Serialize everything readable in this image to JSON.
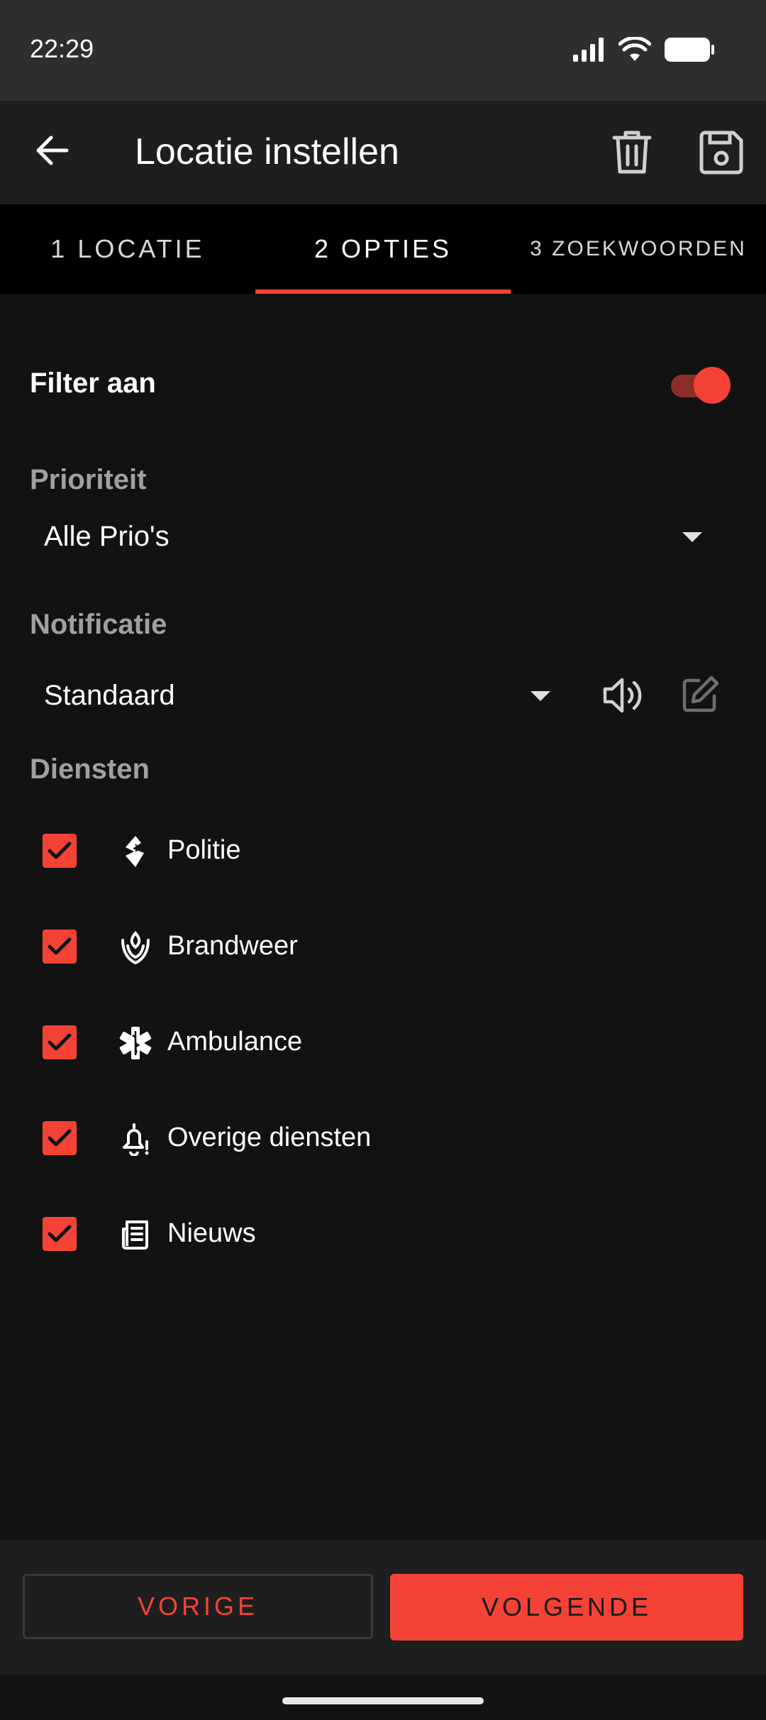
{
  "status_bar": {
    "time": "22:29",
    "icons": [
      "signal-icon",
      "wifi-icon",
      "battery-icon"
    ]
  },
  "app_bar": {
    "title": "Locatie instellen",
    "icons": [
      "back-arrow-icon",
      "trash-icon",
      "save-icon"
    ]
  },
  "tabs": [
    {
      "label": "1 LOCATIE",
      "active": false
    },
    {
      "label": "2 OPTIES",
      "active": true
    },
    {
      "label": "3 ZOEKWOORDEN",
      "active": false
    }
  ],
  "filter": {
    "label": "Filter aan",
    "enabled": true
  },
  "priority": {
    "label": "Prioriteit",
    "value": "Alle Prio's"
  },
  "notification": {
    "label": "Notificatie",
    "value": "Standaard",
    "icons": [
      "speaker-icon",
      "edit-icon"
    ]
  },
  "services": {
    "label": "Diensten",
    "items": [
      {
        "label": "Politie",
        "checked": true,
        "icon": "police-icon"
      },
      {
        "label": "Brandweer",
        "checked": true,
        "icon": "fire-department-icon"
      },
      {
        "label": "Ambulance",
        "checked": true,
        "icon": "ambulance-star-of-life-icon"
      },
      {
        "label": "Overige diensten",
        "checked": true,
        "icon": "bell-alert-icon"
      },
      {
        "label": "Nieuws",
        "checked": true,
        "icon": "newspaper-icon"
      }
    ]
  },
  "footer": {
    "prev_label": "VORIGE",
    "next_label": "VOLGENDE"
  },
  "colors": {
    "accent": "#f44336",
    "background": "#121212",
    "app_bar": "#1e1e1e",
    "tab_bar": "#000000"
  }
}
